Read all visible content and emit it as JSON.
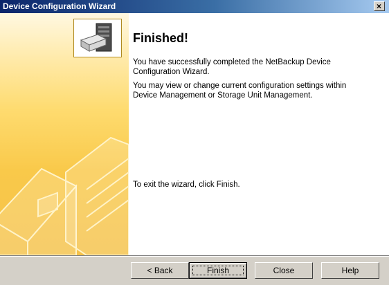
{
  "window": {
    "title": "Device Configuration Wizard",
    "close_label": "×"
  },
  "content": {
    "heading": "Finished!",
    "para1": "You have successfully completed the NetBackup Device Configuration Wizard.",
    "para2": "You may view or change current configuration settings within Device Management or Storage Unit Management.",
    "para3": "To exit the wizard, click Finish."
  },
  "buttons": {
    "back_label": "< Back",
    "finish_label": "Finish",
    "close_label": "Close",
    "help_label": "Help"
  },
  "colors": {
    "titlebar": "#0a246a",
    "panel_gold": "#f9c94a",
    "dialog_gray": "#d4d0c8"
  }
}
